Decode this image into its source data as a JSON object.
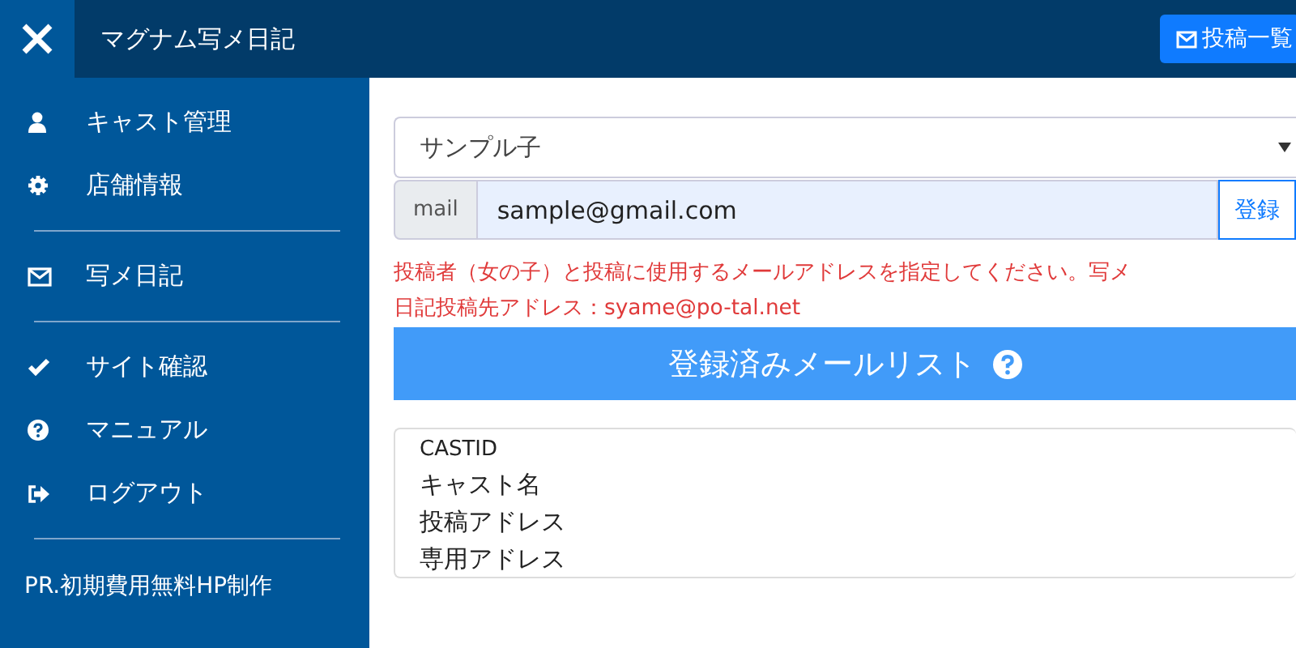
{
  "header": {
    "title": "マグナム写メ日記",
    "button": "投稿一覧"
  },
  "sidebar": {
    "groups": [
      [
        {
          "label": "キャスト管理",
          "kind": "user"
        },
        {
          "label": "店舗情報",
          "kind": "gear"
        }
      ],
      [
        {
          "label": "写メ日記",
          "kind": "mail"
        }
      ],
      [
        {
          "label": "サイト確認",
          "kind": "check"
        },
        {
          "label": "マニュアル",
          "kind": "help"
        },
        {
          "label": "ログアウト",
          "kind": "logout"
        }
      ]
    ],
    "pr": "PR.初期費用無料HP制作"
  },
  "form": {
    "select": "サンプル子",
    "mail_label": "mail",
    "mail_value": "sample@gmail.com",
    "submit": "登録"
  },
  "notice": [
    "投稿者（女の子）と投稿に使用するメールアドレスを指定してください。写メ",
    "日記投稿先アドレス：syame@po-tal.net"
  ],
  "list_header": "登録済みメールリスト",
  "list_fields": [
    "CASTID",
    "キャスト名",
    "投稿アドレス",
    "専用アドレス"
  ]
}
